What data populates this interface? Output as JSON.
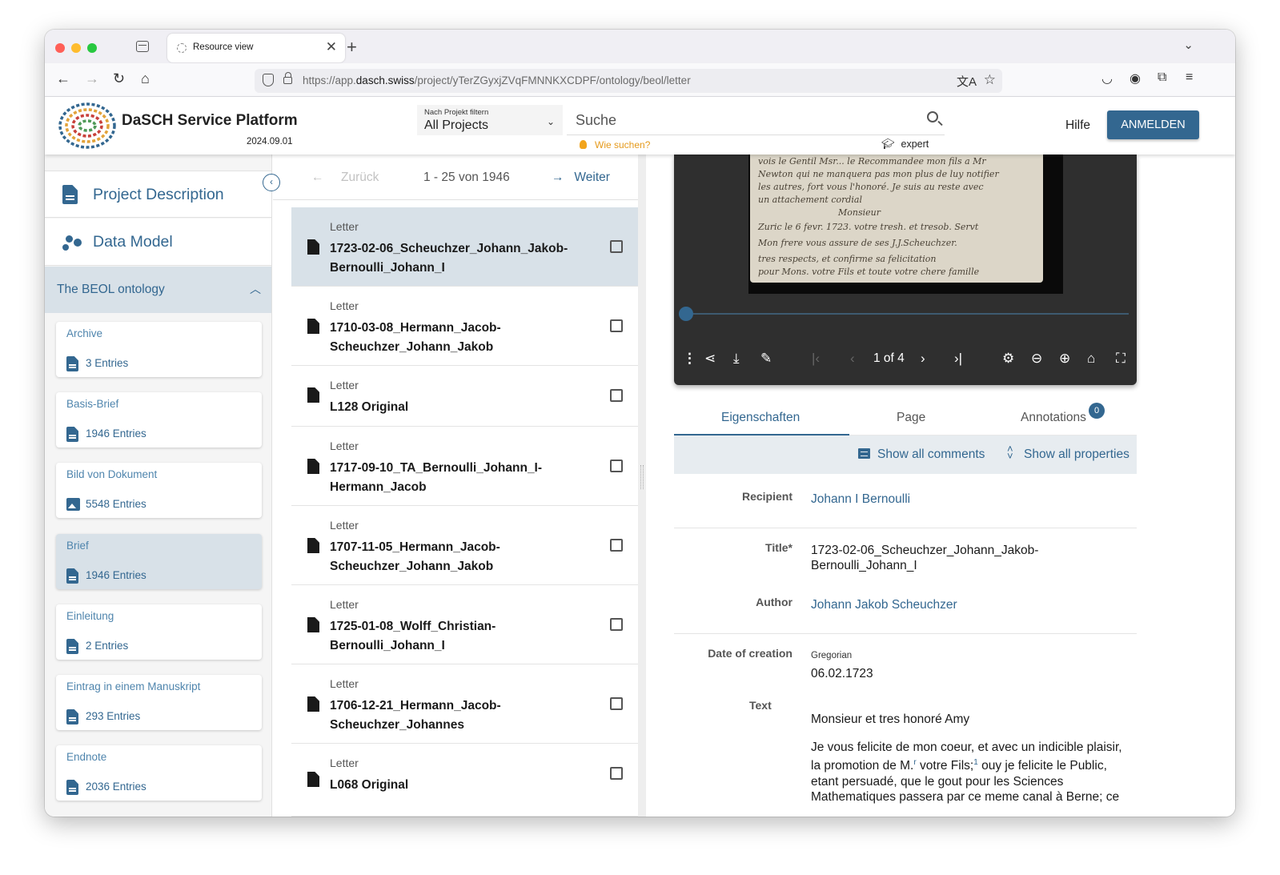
{
  "browser": {
    "tab_title": "Resource view",
    "url_prefix": "https://app.",
    "url_domain": "dasch.swiss",
    "url_path": "/project/yTerZGyxjZVqFMNNKXCDPF/ontology/beol/letter"
  },
  "header": {
    "brand": "DaSCH Service Platform",
    "version": "2024.09.01",
    "filter_label": "Nach Projekt filtern",
    "filter_value": "All Projects",
    "search_placeholder": "Suche",
    "how_to_search": "Wie suchen?",
    "expert": "expert",
    "help": "Hilfe",
    "login": "ANMELDEN"
  },
  "sidebar": {
    "project_description": "Project Description",
    "data_model": "Data Model",
    "ontology": "The BEOL ontology",
    "classes": [
      {
        "name": "Archive",
        "count": "3 Entries",
        "icon": "document-icon"
      },
      {
        "name": "Basis-Brief",
        "count": "1946 Entries",
        "icon": "document-icon"
      },
      {
        "name": "Bild von Dokument",
        "count": "5548 Entries",
        "icon": "image-icon"
      },
      {
        "name": "Brief",
        "count": "1946 Entries",
        "icon": "document-icon",
        "selected": true
      },
      {
        "name": "Einleitung",
        "count": "2 Entries",
        "icon": "document-icon"
      },
      {
        "name": "Eintrag in einem Manuskript",
        "count": "293 Entries",
        "icon": "document-icon"
      },
      {
        "name": "Endnote",
        "count": "2036 Entries",
        "icon": "document-icon"
      }
    ]
  },
  "list": {
    "back": "Zurück",
    "range": "1 - 25 von 1946",
    "next": "Weiter",
    "rows": [
      {
        "type": "Letter",
        "label": "1723-02-06_Scheuchzer_Johann_Jakob-Bernoulli_Johann_I"
      },
      {
        "type": "Letter",
        "label": "1710-03-08_Hermann_Jacob-Scheuchzer_Johann_Jakob"
      },
      {
        "type": "Letter",
        "label": "L128 Original"
      },
      {
        "type": "Letter",
        "label": "1717-09-10_TA_Bernoulli_Johann_I-Hermann_Jacob"
      },
      {
        "type": "Letter",
        "label": "1707-11-05_Hermann_Jacob-Scheuchzer_Johann_Jakob"
      },
      {
        "type": "Letter",
        "label": "1725-01-08_Wolff_Christian-Bernoulli_Johann_I"
      },
      {
        "type": "Letter",
        "label": "1706-12-21_Hermann_Jacob-Scheuchzer_Johannes"
      },
      {
        "type": "Letter",
        "label": "L068 Original"
      }
    ]
  },
  "viewer": {
    "page_count": "1 of 4"
  },
  "resource": {
    "tabs": [
      "Eigenschaften",
      "Page",
      "Annotations"
    ],
    "annotations_badge": "0",
    "show_comments": "Show all comments",
    "show_properties": "Show all properties",
    "props": {
      "recipient_key": "Recipient",
      "recipient_val": "Johann I Bernoulli",
      "title_key": "Title*",
      "title_val": "1723-02-06_Scheuchzer_Johann_Jakob-Bernoulli_Johann_I",
      "author_key": "Author",
      "author_val": "Johann Jakob Scheuchzer",
      "date_key": "Date of creation",
      "date_cal": "Gregorian",
      "date_val": "06.02.1723",
      "text_key": "Text",
      "text_p1": "Monsieur et tres honoré Amy",
      "text_p2a": "Je vous felicite de mon coeur, et avec un indicible plaisir, la promotion de M.",
      "text_p2_sup_r": "r",
      "text_p2b": " votre Fils;",
      "text_p2_sup_1": "1",
      "text_p2c": " ouy je felicite le Public, etant persuadé, que le gout pour les Sciences Mathematiques passera par ce meme canal à Berne; ce"
    }
  },
  "colors": {
    "accent": "#336790",
    "selected_bg": "#d8e1e8"
  }
}
